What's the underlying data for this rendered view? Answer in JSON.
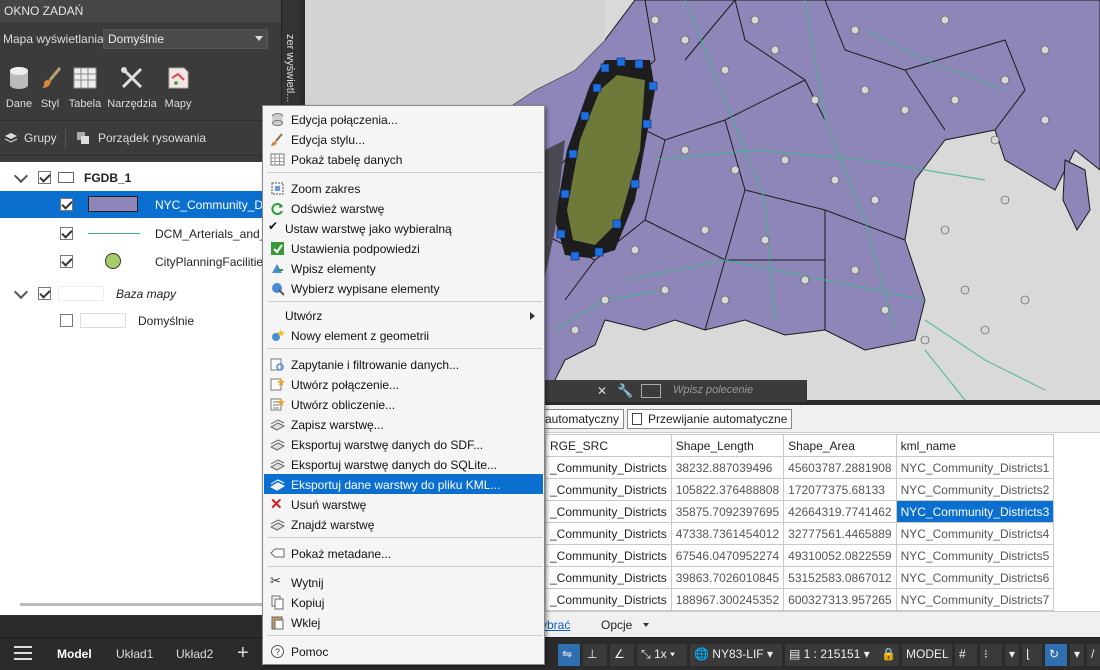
{
  "taskpane": {
    "title": "OKNO ZADAŃ",
    "side_tab": "zer wyświetl...",
    "map_view_label": "Mapa wyświetlania:",
    "map_view_value": "Domyślnie",
    "ribbon": [
      {
        "label": "Dane",
        "icon": "database-icon"
      },
      {
        "label": "Styl",
        "icon": "brush-icon"
      },
      {
        "label": "Tabela",
        "icon": "table-icon"
      },
      {
        "label": "Narzędzia",
        "icon": "tools-icon"
      },
      {
        "label": "Mapy",
        "icon": "map-icon"
      }
    ],
    "groups_label": "Grupy",
    "draw_order_label": "Porządek rysowania",
    "tree": {
      "group1": "FGDB_1",
      "layer1": "NYC_Community_D",
      "layer2": "DCM_Arterials_and_I",
      "layer3": "CityPlanningFacilitie",
      "group2": "Baza mapy",
      "layer4": "Domyślnie"
    }
  },
  "context_menu": {
    "items": [
      {
        "label": "Edycja połączenia...",
        "icon": "database-icon"
      },
      {
        "label": "Edycja stylu...",
        "icon": "brush-icon"
      },
      {
        "label": "Pokaż tabelę danych",
        "icon": "table-icon"
      },
      {
        "label": "Zoom zakres",
        "icon": "zoom-icon"
      },
      {
        "label": "Odśwież warstwę",
        "icon": "refresh-icon"
      },
      {
        "label": "Ustaw warstwę jako wybieralną",
        "icon": "checkmark-icon"
      },
      {
        "label": "Ustawienia podpowiedzi",
        "icon": "tooltip-settings-icon"
      },
      {
        "label": "Wpisz elementy",
        "icon": "check-in-icon"
      },
      {
        "label": "Wybierz wypisane elementy",
        "icon": "select-checked-out-icon"
      },
      {
        "label": "Utwórz",
        "icon": ""
      },
      {
        "label": "Nowy element z geometrii",
        "icon": "new-feature-icon"
      },
      {
        "label": "Zapytanie i filtrowanie danych...",
        "icon": "query-icon"
      },
      {
        "label": "Utwórz połączenie...",
        "icon": "join-icon"
      },
      {
        "label": "Utwórz obliczenie...",
        "icon": "calculator-icon"
      },
      {
        "label": "Zapisz warstwę...",
        "icon": "save-layer-icon"
      },
      {
        "label": "Eksportuj warstwę danych do SDF...",
        "icon": "export-icon"
      },
      {
        "label": "Eksportuj warstwę danych do SQLite...",
        "icon": "export-icon"
      },
      {
        "label": "Eksportuj dane warstwy do pliku KML...",
        "icon": "export-icon"
      },
      {
        "label": "Usuń warstwę",
        "icon": "delete-icon"
      },
      {
        "label": "Znajdź warstwę",
        "icon": "find-layer-icon"
      },
      {
        "label": "Pokaż metadane...",
        "icon": "metadata-icon"
      },
      {
        "label": "Wytnij",
        "icon": "cut-icon"
      },
      {
        "label": "Kopiuj",
        "icon": "copy-icon"
      },
      {
        "label": "Wklej",
        "icon": "paste-icon"
      },
      {
        "label": "Pomoc",
        "icon": "help-icon"
      }
    ]
  },
  "command": {
    "placeholder": "Wpisz polecenie"
  },
  "data_table": {
    "btn_auto": "automatyczny",
    "btn_autopan": "Przewijanie automatyczne",
    "columns": [
      "RGE_SRC",
      "Shape_Length",
      "Shape_Area",
      "kml_name"
    ],
    "rows": [
      [
        "_Community_Districts",
        "38232.887039496",
        "45603787.2881908",
        "NYC_Community_Districts1"
      ],
      [
        "_Community_Districts",
        "105822.376488808",
        "172077375.68133",
        "NYC_Community_Districts2"
      ],
      [
        "_Community_Districts",
        "35875.7092397695",
        "42664319.7741462",
        "NYC_Community_Districts3"
      ],
      [
        "_Community_Districts",
        "47338.7361454012",
        "32777561.4465889",
        "NYC_Community_Districts4"
      ],
      [
        "_Community_Districts",
        "67546.0470952274",
        "49310052.0822559",
        "NYC_Community_Districts5"
      ],
      [
        "_Community_Districts",
        "39863.7026010845",
        "53152583.0867012",
        "NYC_Community_Districts6"
      ],
      [
        "_Community_Districts",
        "188967.300245352",
        "600327313.957265",
        "NYC_Community_Districts7"
      ]
    ],
    "footer_link": "ybrać",
    "footer_options": "Opcje"
  },
  "status": {
    "tab_model": "Model",
    "tab_layout1": "Układ1",
    "tab_layout2": "Układ2",
    "scale_mult": "1x",
    "coord_system": "NY83-LIF",
    "scale": "1 : 215151",
    "space": "MODEL"
  },
  "colors": {
    "district_fill": "#8e86b8",
    "selected_fill": "#6b7a3a",
    "selection_blue": "#0b6fd0",
    "road": "#3fb58f"
  }
}
